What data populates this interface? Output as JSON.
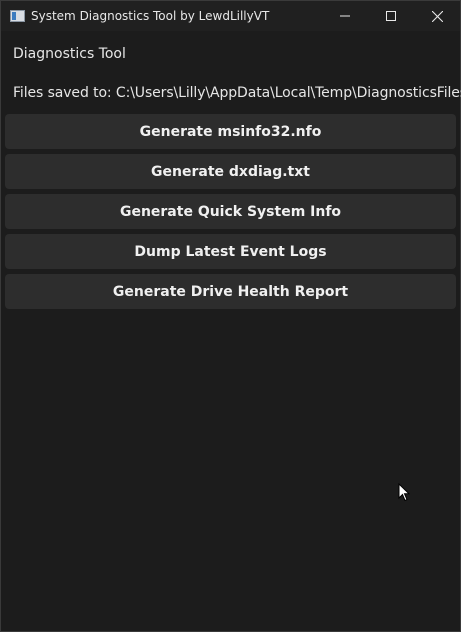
{
  "window": {
    "title": "System Diagnostics Tool by LewdLillyVT"
  },
  "labels": {
    "heading": "Diagnostics Tool",
    "save_path": "Files saved to: C:\\Users\\Lilly\\AppData\\Local\\Temp\\DiagnosticsFiles"
  },
  "buttons": [
    {
      "label": "Generate msinfo32.nfo"
    },
    {
      "label": "Generate dxdiag.txt"
    },
    {
      "label": "Generate Quick System Info"
    },
    {
      "label": "Dump Latest Event Logs"
    },
    {
      "label": "Generate Drive Health Report"
    }
  ],
  "colors": {
    "background": "#1c1c1c",
    "titlebar": "#202020",
    "button": "#2d2d2d",
    "text": "#e6e6e6"
  }
}
